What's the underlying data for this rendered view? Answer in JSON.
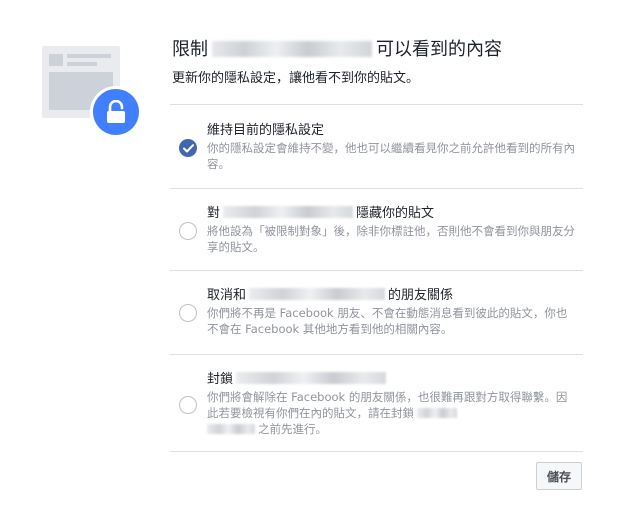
{
  "dialog": {
    "title_prefix": "限制",
    "title_suffix": "可以看到的內容",
    "subtitle": "更新你的隱私設定，讓他看不到你的貼文。"
  },
  "options": [
    {
      "title": "維持目前的隱私設定",
      "description": "你的隱私設定會維持不變，他也可以繼續看見你之前允許他看到的所有內容。",
      "selected": true
    },
    {
      "title_prefix": "對",
      "title_suffix": "隱藏你的貼文",
      "description": "將他設為「被限制對象」後，除非你標註他，否則他不會看到你與朋友分享的貼文。",
      "selected": false
    },
    {
      "title_prefix": "取消和",
      "title_suffix": "的朋友關係",
      "description": "你們將不再是 Facebook 朋友、不會在動態消息看到彼此的貼文，你也不會在 Facebook 其他地方看到他的相關內容。",
      "selected": false
    },
    {
      "title_prefix": "封鎖",
      "description_line1": "你們將會解除在 Facebook 的朋友關係，也很難再跟對方取得聯繫。因此若要檢視有你們在內的貼文，請在封鎖",
      "description_line2": "之前先進行。",
      "selected": false
    }
  ],
  "footer": {
    "save_label": "儲存"
  },
  "icons": {
    "lock": "lock-icon",
    "check": "check-icon"
  },
  "colors": {
    "accent": "#4267b2",
    "lock_badge": "#4080ff",
    "muted_text": "#90949c",
    "divider": "#dddfe2"
  }
}
